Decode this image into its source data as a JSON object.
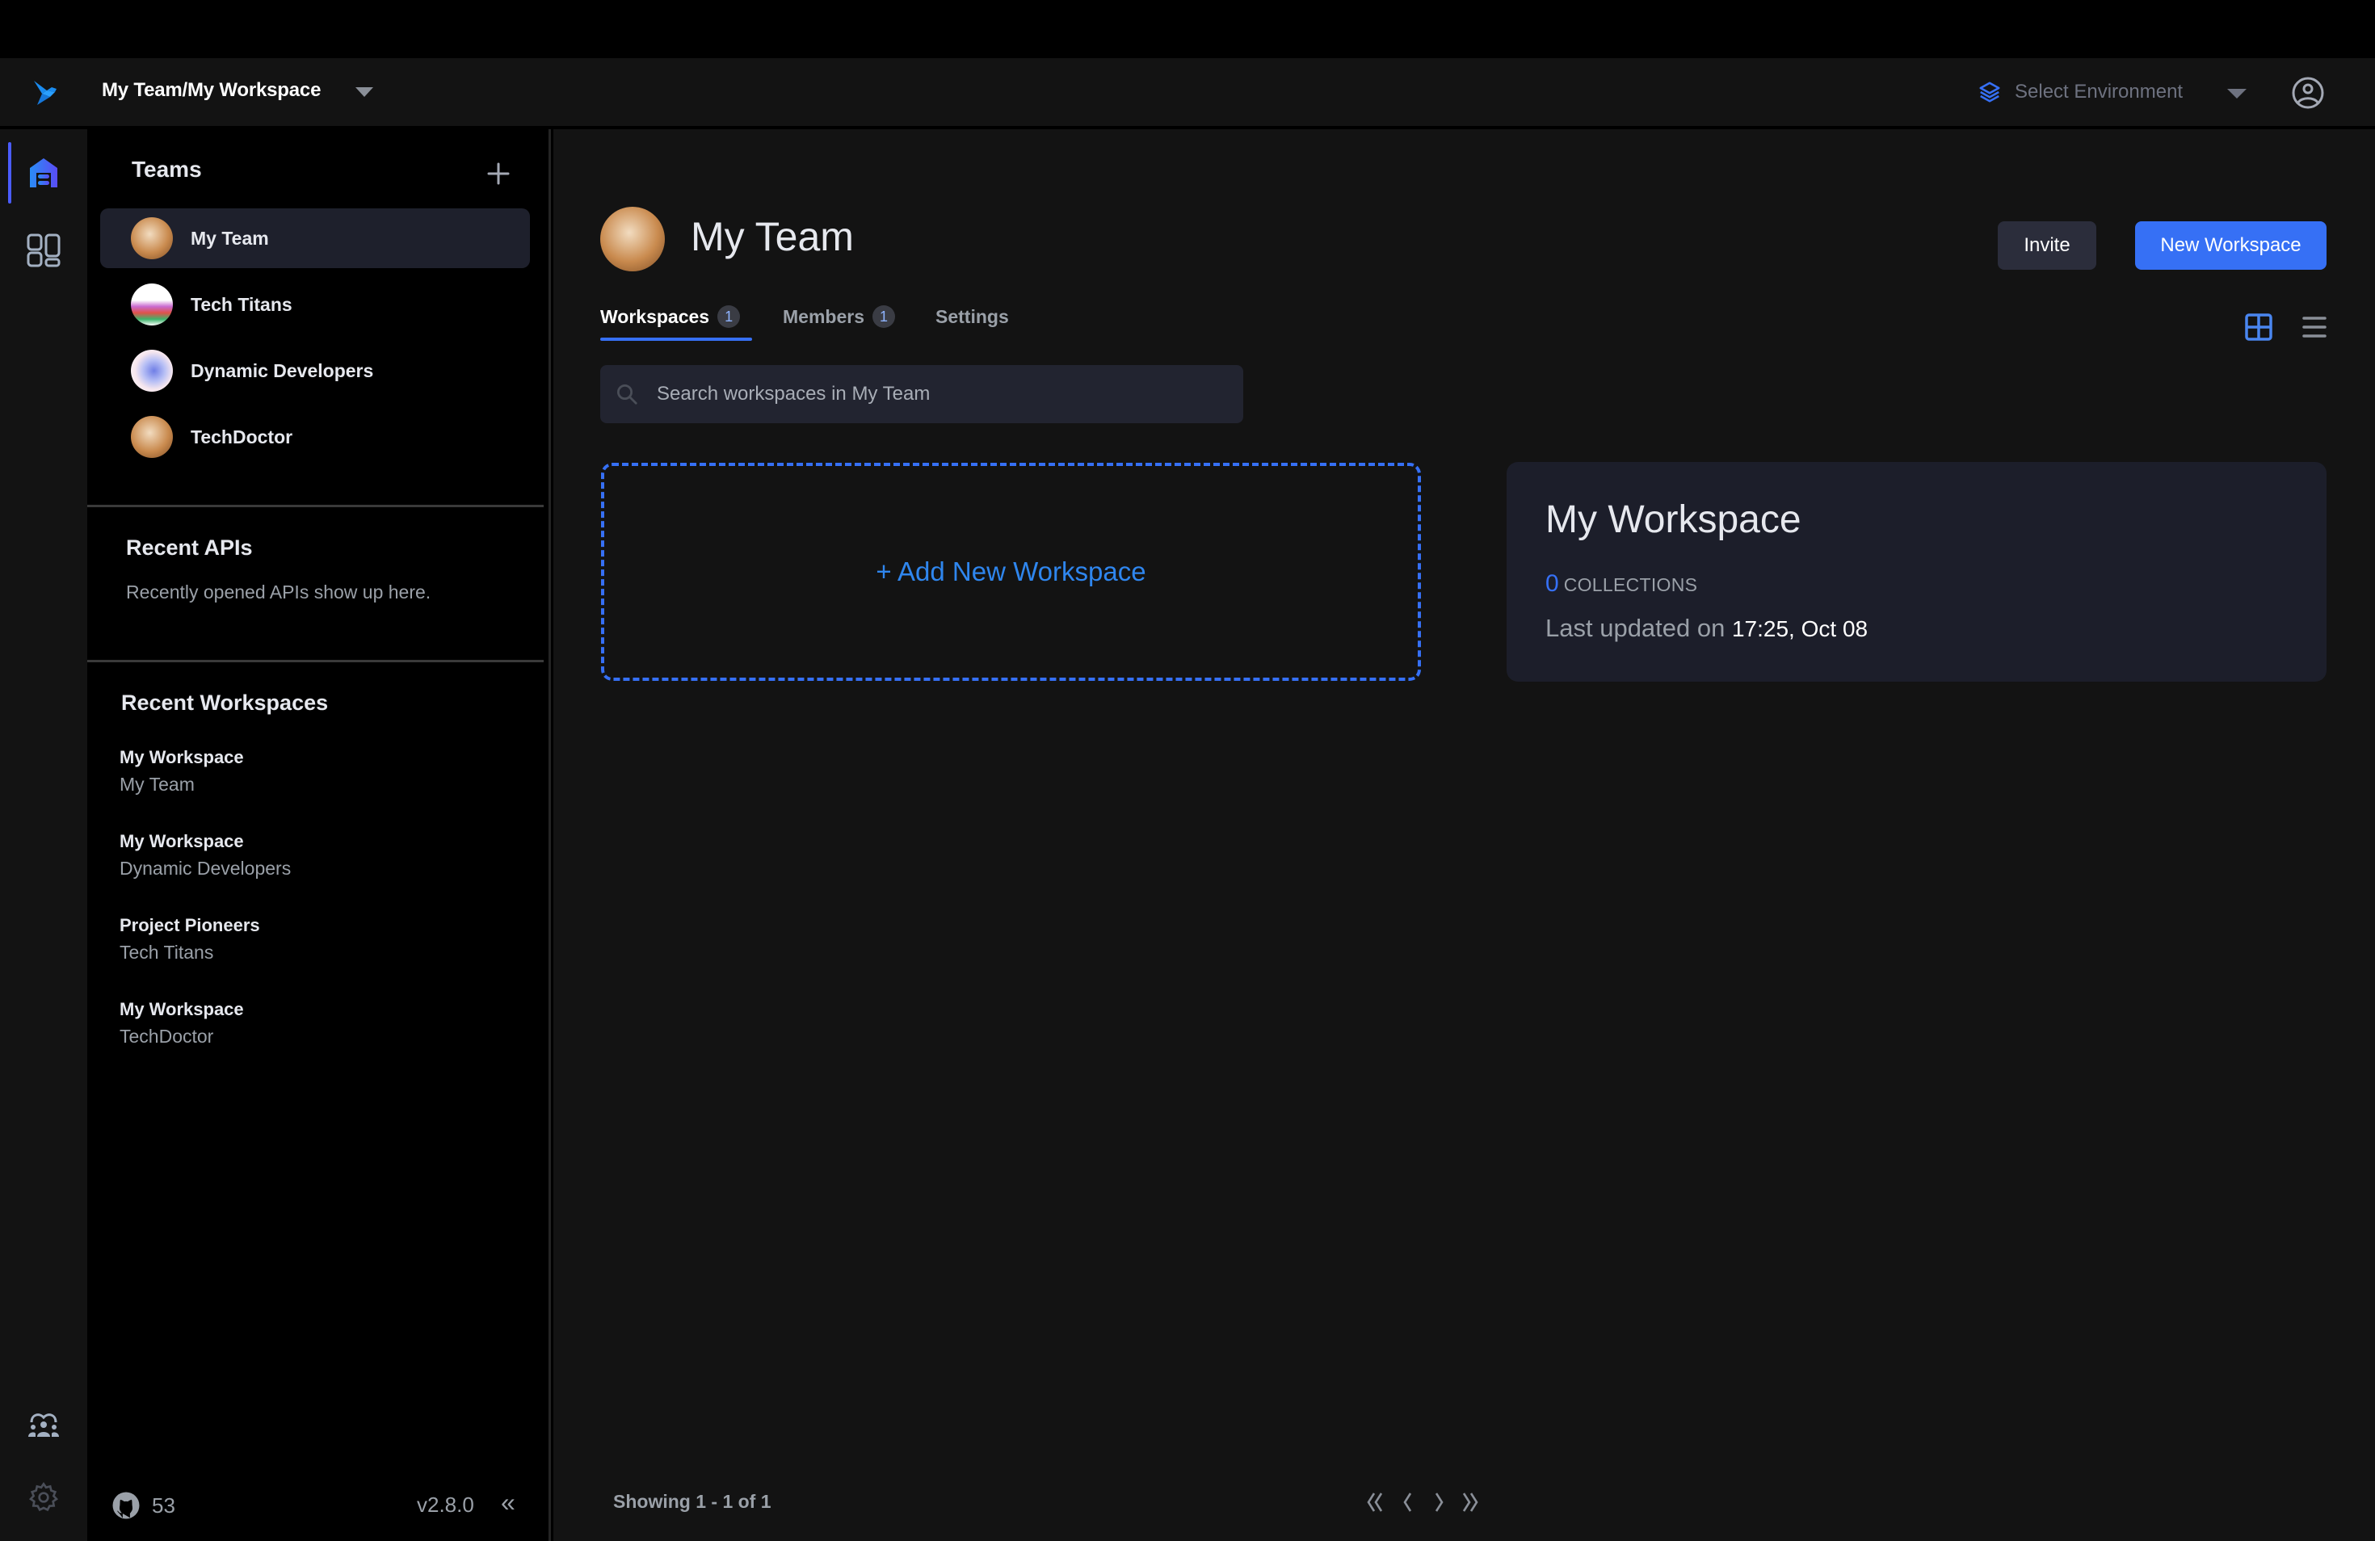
{
  "header": {
    "workspace_path": "My Team/My Workspace",
    "environment_placeholder": "Select Environment",
    "logo_icon": "sparrow-bird-icon",
    "user_icon": "user-circle-icon"
  },
  "rail": {
    "items": [
      {
        "name": "home",
        "icon": "home-icon",
        "active": true
      },
      {
        "name": "workspaces",
        "icon": "dashboard-grid-icon",
        "active": false
      },
      {
        "name": "community",
        "icon": "community-icon",
        "active": false
      },
      {
        "name": "settings",
        "icon": "gear-icon",
        "active": false
      }
    ]
  },
  "sidebar": {
    "teams_title": "Teams",
    "teams": [
      {
        "name": "My Team",
        "active": true
      },
      {
        "name": "Tech Titans",
        "active": false
      },
      {
        "name": "Dynamic Developers",
        "active": false
      },
      {
        "name": "TechDoctor",
        "active": false
      }
    ],
    "recent_apis_title": "Recent APIs",
    "recent_apis_empty": "Recently opened APIs show up here.",
    "recent_workspaces_title": "Recent Workspaces",
    "recent_workspaces": [
      {
        "workspace": "My Workspace",
        "team": "My Team"
      },
      {
        "workspace": "My Workspace",
        "team": "Dynamic Developers"
      },
      {
        "workspace": "Project Pioneers",
        "team": "Tech Titans"
      },
      {
        "workspace": "My Workspace",
        "team": "TechDoctor"
      }
    ],
    "github_stars": "53",
    "version": "v2.8.0",
    "collapse_glyph": "«"
  },
  "main": {
    "team_title": "My Team",
    "invite_label": "Invite",
    "new_workspace_label": "New Workspace",
    "tabs": [
      {
        "label": "Workspaces",
        "badge": "1",
        "active": true
      },
      {
        "label": "Members",
        "badge": "1",
        "active": false
      },
      {
        "label": "Settings",
        "badge": null,
        "active": false
      }
    ],
    "view_mode": "grid",
    "search_placeholder": "Search workspaces in My Team",
    "search_value": "",
    "add_workspace_label": "+ Add New Workspace",
    "workspaces": [
      {
        "name": "My Workspace",
        "collections_count": "0",
        "collections_label": "COLLECTIONS",
        "updated_prefix": "Last updated on",
        "updated_at": "17:25, Oct 08"
      }
    ],
    "pagination": {
      "text": "Showing 1 - 1 of 1",
      "first": "«",
      "prev": "‹",
      "next": "›",
      "last": "»"
    }
  },
  "colors": {
    "accent": "#3670f5",
    "link": "#2f86ee",
    "background": "#131313",
    "sidebar": "#000000",
    "card": "#1c1e2a"
  }
}
